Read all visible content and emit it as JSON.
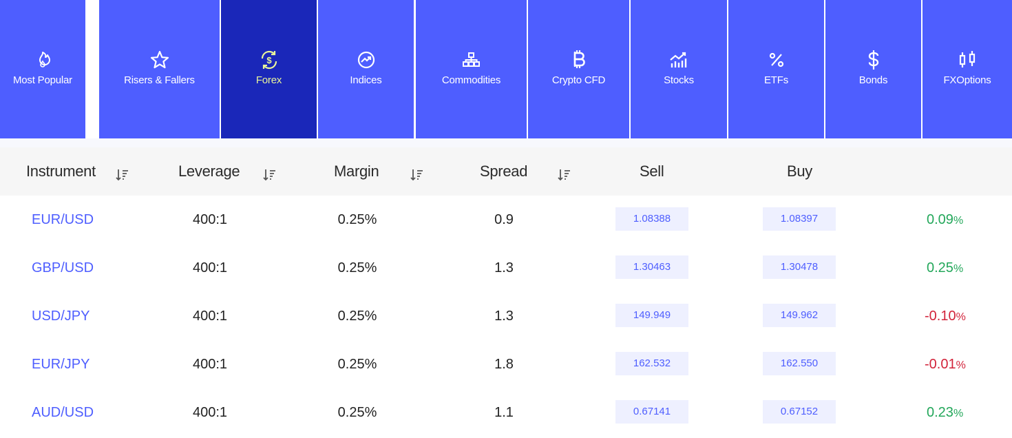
{
  "tabs": [
    {
      "label": "Most Popular",
      "icon": "fire-icon"
    },
    {
      "label": "Risers & Fallers",
      "icon": "star-icon"
    },
    {
      "label": "Forex",
      "icon": "currency-exchange-icon",
      "active": true
    },
    {
      "label": "Indices",
      "icon": "trending-up-icon"
    },
    {
      "label": "Commodities",
      "icon": "boxes-icon"
    },
    {
      "label": "Crypto CFD",
      "icon": "bitcoin-icon"
    },
    {
      "label": "Stocks",
      "icon": "stock-chart-icon"
    },
    {
      "label": "ETFs",
      "icon": "percent-icon"
    },
    {
      "label": "Bonds",
      "icon": "dollar-icon"
    },
    {
      "label": "FXOptions",
      "icon": "candlestick-icon"
    }
  ],
  "table": {
    "headers": {
      "instrument": "Instrument",
      "leverage": "Leverage",
      "margin": "Margin",
      "spread": "Spread",
      "sell": "Sell",
      "buy": "Buy"
    },
    "rows": [
      {
        "instrument": "EUR/USD",
        "leverage": "400:1",
        "margin": "0.25%",
        "spread": "0.9",
        "sell": "1.08388",
        "buy": "1.08397",
        "change": "0.09",
        "pct": "%",
        "direction": "up"
      },
      {
        "instrument": "GBP/USD",
        "leverage": "400:1",
        "margin": "0.25%",
        "spread": "1.3",
        "sell": "1.30463",
        "buy": "1.30478",
        "change": "0.25",
        "pct": "%",
        "direction": "up"
      },
      {
        "instrument": "USD/JPY",
        "leverage": "400:1",
        "margin": "0.25%",
        "spread": "1.3",
        "sell": "149.949",
        "buy": "149.962",
        "change": "-0.10",
        "pct": "%",
        "direction": "down"
      },
      {
        "instrument": "EUR/JPY",
        "leverage": "400:1",
        "margin": "0.25%",
        "spread": "1.8",
        "sell": "162.532",
        "buy": "162.550",
        "change": "-0.01",
        "pct": "%",
        "direction": "down"
      },
      {
        "instrument": "AUD/USD",
        "leverage": "400:1",
        "margin": "0.25%",
        "spread": "1.1",
        "sell": "0.67141",
        "buy": "0.67152",
        "change": "0.23",
        "pct": "%",
        "direction": "up"
      }
    ]
  },
  "colors": {
    "tab_bg": "#4e5eff",
    "tab_active_bg": "#1a27b9",
    "tab_active_text": "#e9f59a",
    "link": "#4e5eff",
    "up": "#23a75a",
    "down": "#d2233a",
    "price_box_bg": "#eef0ff"
  }
}
